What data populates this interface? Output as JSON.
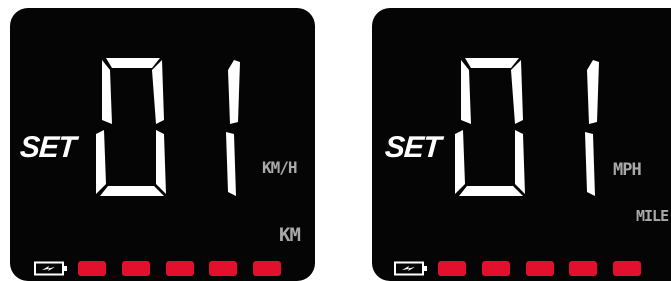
{
  "left_display": {
    "mode_label": "SET",
    "value": "01",
    "speed_unit": "KM/H",
    "distance_unit": "KM",
    "battery_icon": "battery-charging-icon",
    "level_bars": 5,
    "bar_color": "#e2102c"
  },
  "right_display": {
    "mode_label": "SET",
    "value": "01",
    "speed_unit": "MPH",
    "distance_unit": "MILE",
    "battery_icon": "battery-charging-icon",
    "level_bars": 5,
    "bar_color": "#e2102c"
  },
  "colors": {
    "screen": "#050505",
    "segment": "#ffffff",
    "unit_text": "#a9a9a9",
    "level_bar": "#e2102c"
  }
}
